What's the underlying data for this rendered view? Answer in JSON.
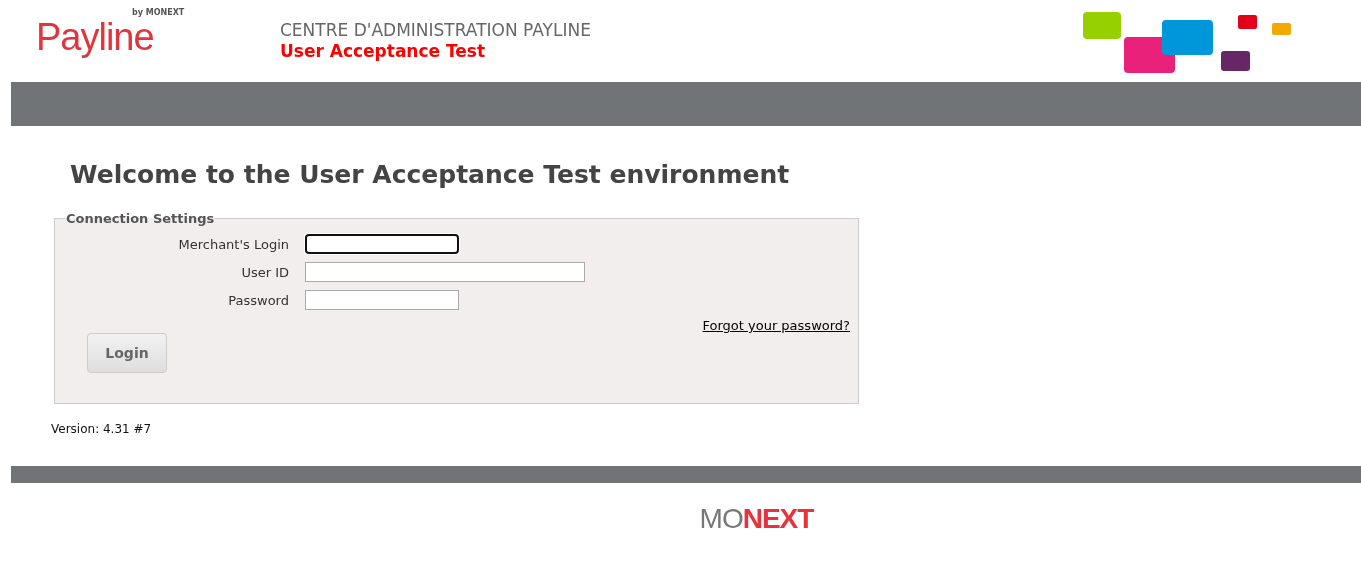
{
  "header": {
    "logo": {
      "name": "Payline",
      "byline": "by MONEXT"
    },
    "title": "CENTRE D'ADMINISTRATION PAYLINE",
    "environment": "User Acceptance Test"
  },
  "heading": "Welcome to the User Acceptance Test environment",
  "connection_settings": {
    "legend": "Connection Settings",
    "fields": [
      {
        "label": "Merchant's Login",
        "focused": true
      },
      {
        "label": "User ID",
        "focused": false
      },
      {
        "label": "Password",
        "focused": false
      }
    ],
    "forgot_link": "Forgot your password?",
    "button": "Login"
  },
  "version": "Version: 4.31 #7",
  "footer": {
    "logo_light": "MO",
    "logo_bold": "NEXT"
  }
}
